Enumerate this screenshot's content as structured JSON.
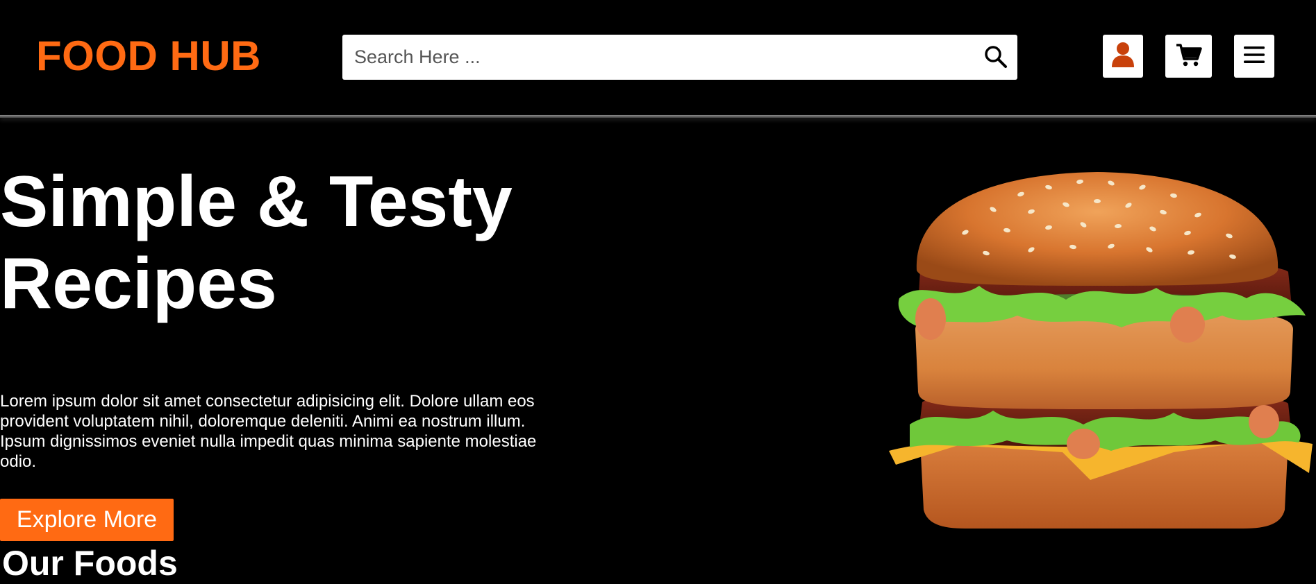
{
  "header": {
    "logo": "FOOD HUB",
    "search": {
      "placeholder": "Search Here ...",
      "value": "",
      "icon": "search-icon"
    },
    "icons": [
      "user-icon",
      "cart-icon",
      "menu-icon"
    ]
  },
  "hero": {
    "title": "Simple & Testy Recipes",
    "text": "Lorem ipsum dolor sit amet consectetur adipisicing elit. Dolore ullam eos provident voluptatem nihil, doloremque deleniti. Animi ea nostrum illum. Ipsum dignissimos eveniet nulla impedit quas minima sapiente molestiae odio.",
    "button_label": "Explore More",
    "image": "burger"
  },
  "section": {
    "title": "Our Foods"
  },
  "colors": {
    "brand": "#ff6a13",
    "background": "#000000",
    "user_icon": "#c8410b"
  }
}
